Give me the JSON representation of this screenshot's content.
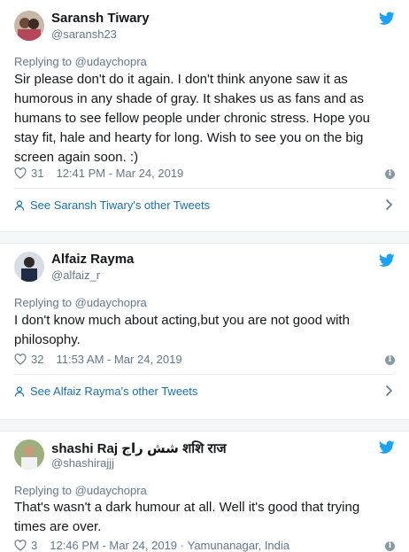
{
  "tweets": [
    {
      "name": "Saransh Tiwary",
      "handle": "@saransh23",
      "replying_to": "Replying to @udaychopra",
      "text": "Sir please don't do it again. I don't think anyone saw it as humorous in any shade of gray. It shakes us as fans and as humans to see fellow people under chronic stress. Hope you stay fit, hale and hearty for long. Wish to see you on the big screen again soon. :)",
      "likes": "31",
      "timestamp": "12:41 PM - Mar 24, 2019",
      "other_tweets": "See Saransh Tiwary's other Tweets"
    },
    {
      "name": "Alfaiz Rayma",
      "handle": "@alfaiz_r",
      "replying_to": "Replying to @udaychopra",
      "text": "I don't know much about acting,but you are not good with philosophy.",
      "likes": "32",
      "timestamp": "11:53 AM - Mar 24, 2019",
      "other_tweets": "See Alfaiz Rayma's other Tweets"
    },
    {
      "name": "shashi Raj شش راج शशि राज",
      "handle": "@shashirajjj",
      "replying_to": "Replying to @udaychopra",
      "text": "That's wasn't a dark humour at all. Well it's good that trying times are over.",
      "likes": "3",
      "timestamp": "12:46 PM - Mar 24, 2019",
      "location": "Yamunanagar, India"
    }
  ],
  "colors": {
    "twitter_blue": "#1da1f2",
    "link_blue": "#1b6fa8",
    "secondary_text": "#657786"
  },
  "icons": [
    "twitter-bird-icon",
    "heart-icon",
    "info-icon",
    "person-icon",
    "chevron-right-icon"
  ]
}
